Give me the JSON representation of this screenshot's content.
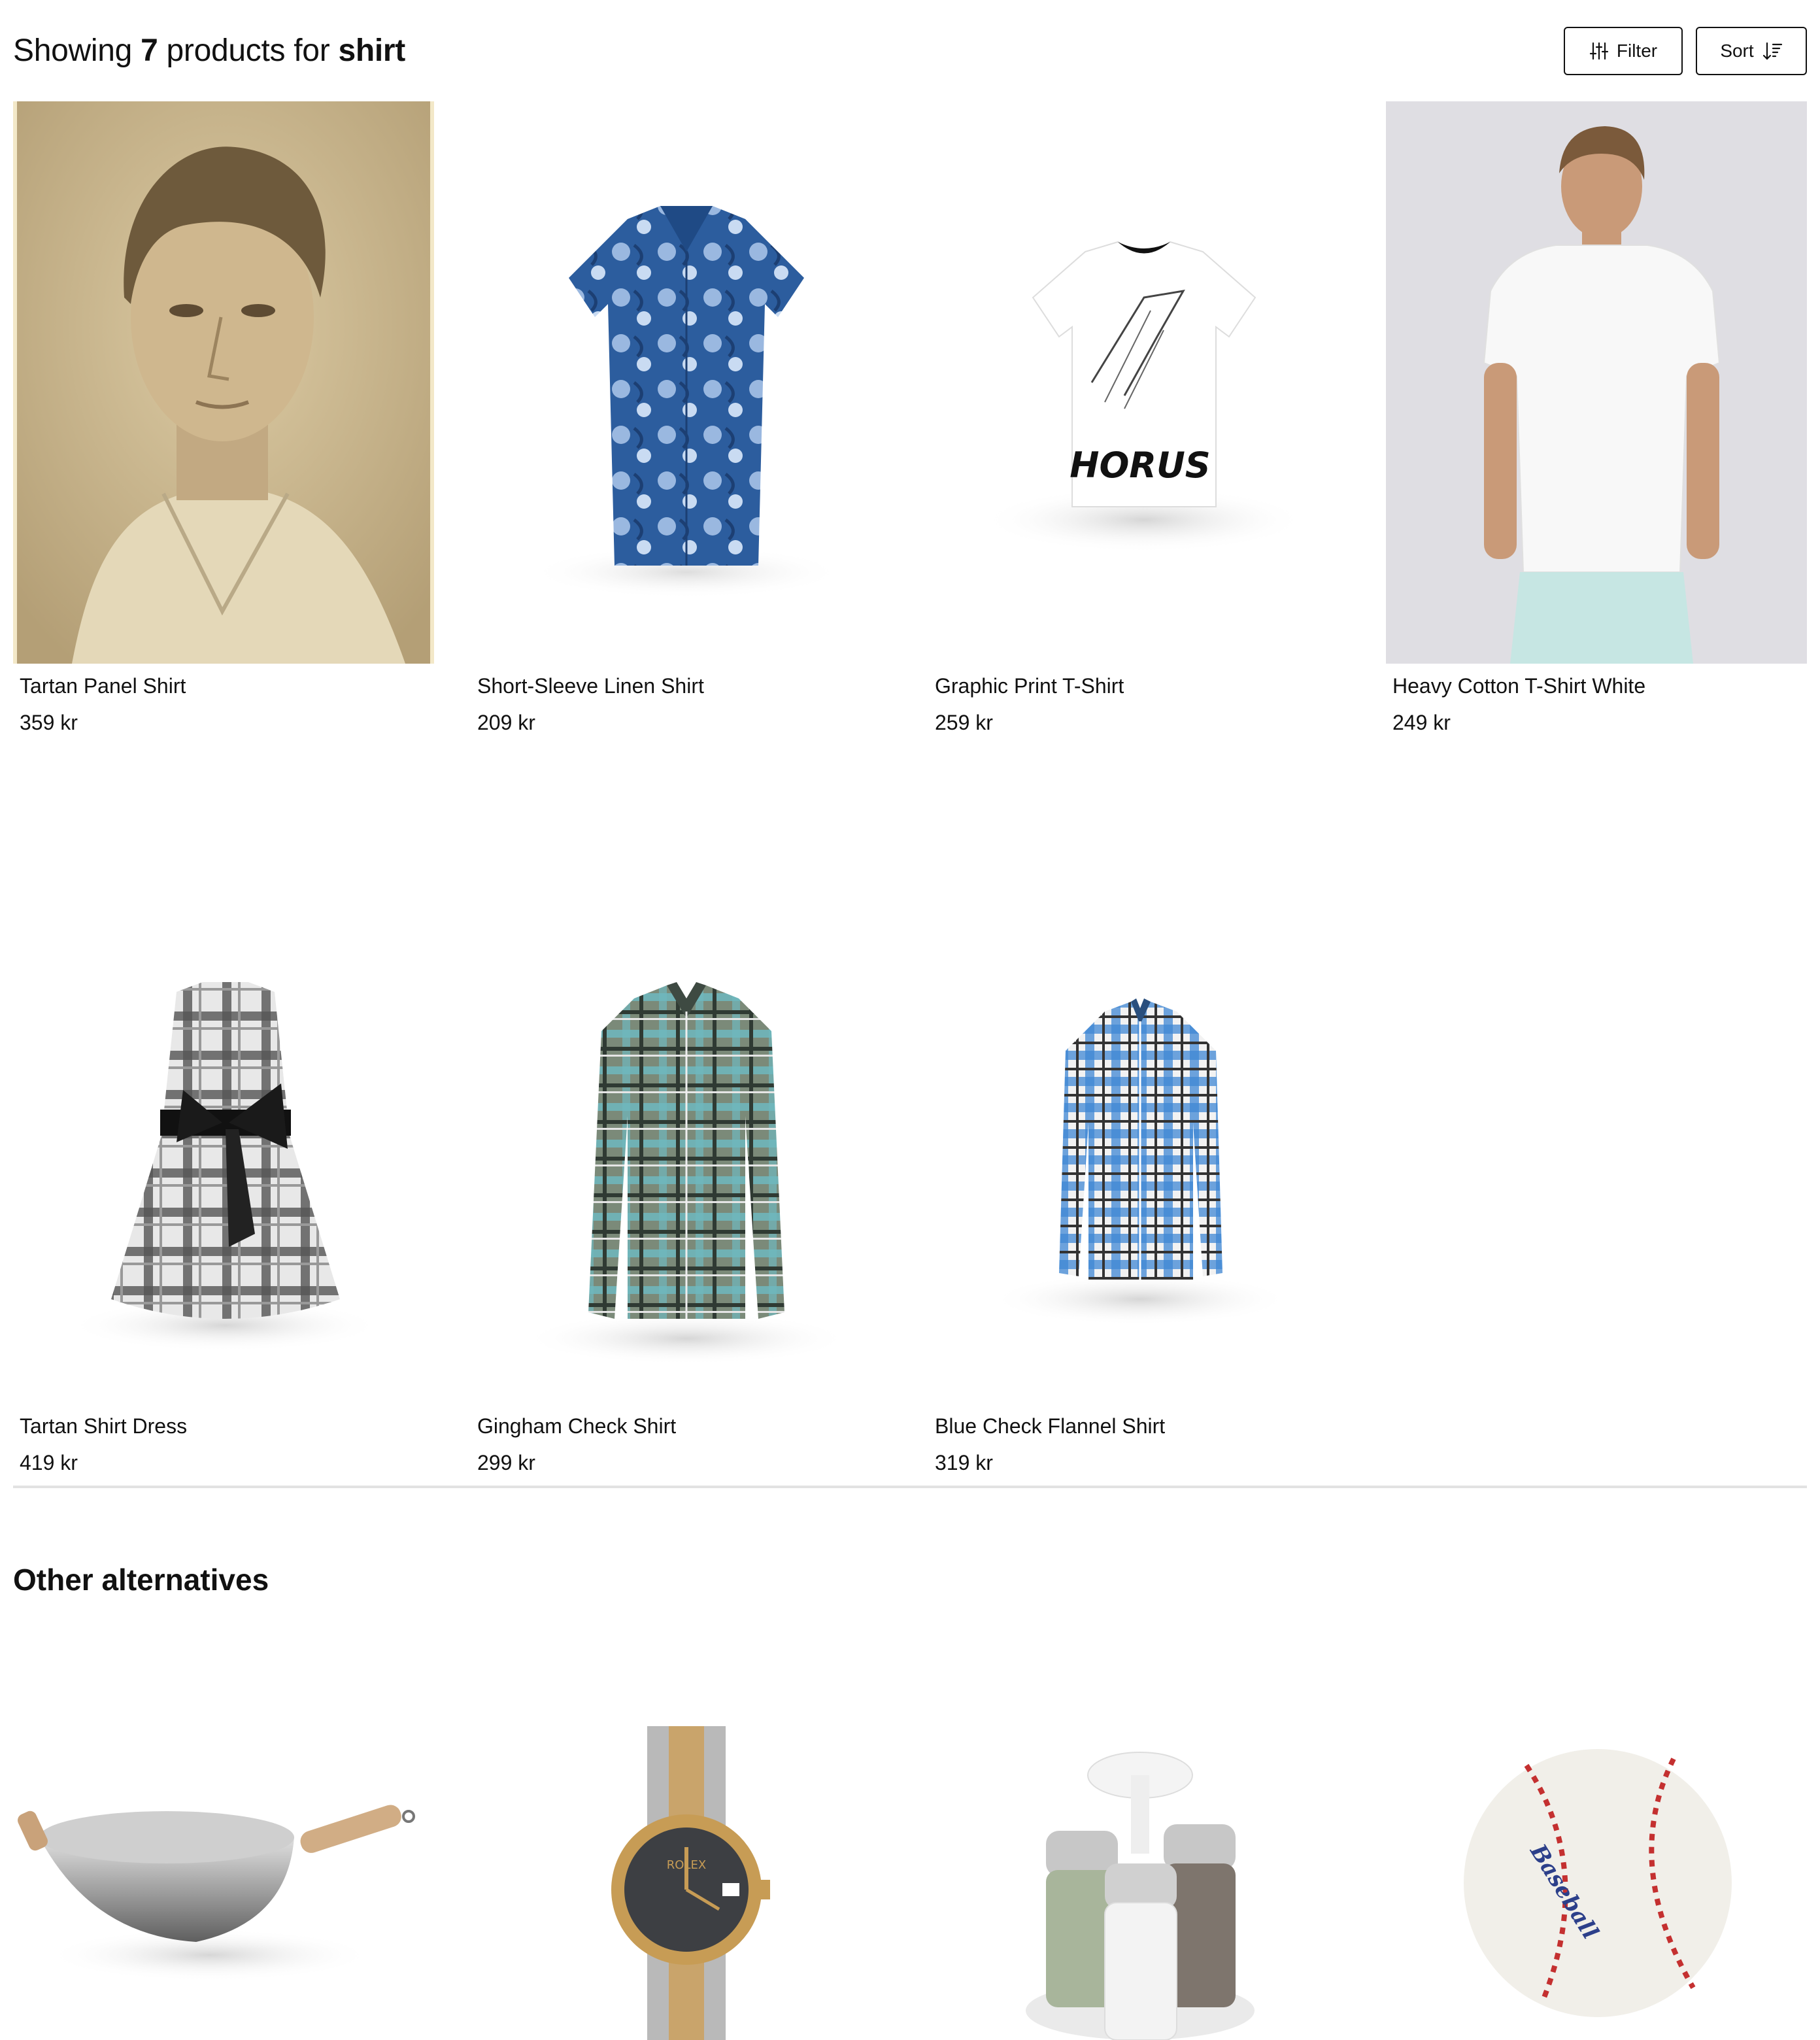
{
  "results": {
    "prefix": "Showing",
    "count": "7",
    "middle": "products for",
    "query": "shirt"
  },
  "toolbar": {
    "filter_label": "Filter",
    "filter_icon": "sliders-icon",
    "sort_label": "Sort",
    "sort_icon": "sort-descending-icon"
  },
  "products": [
    {
      "name": "Tartan Panel Shirt",
      "price": "359 kr"
    },
    {
      "name": "Short-Sleeve Linen Shirt",
      "price": "209 kr"
    },
    {
      "name": "Graphic Print T-Shirt",
      "price": "259 kr",
      "print_text": "HORUS"
    },
    {
      "name": "Heavy Cotton T-Shirt White",
      "price": "249 kr"
    },
    {
      "name": "Tartan Shirt Dress",
      "price": "419 kr"
    },
    {
      "name": "Gingham Check Shirt",
      "price": "299 kr"
    },
    {
      "name": "Blue Check Flannel Shirt",
      "price": "319 kr"
    }
  ],
  "alternatives": {
    "title": "Other alternatives",
    "items": [
      {
        "icon": "wok-icon"
      },
      {
        "icon": "watch-icon",
        "dial_text": "ROLEX"
      },
      {
        "icon": "salt-pepper-shakers-icon"
      },
      {
        "icon": "baseball-icon",
        "print_text": "Baseball"
      }
    ]
  }
}
